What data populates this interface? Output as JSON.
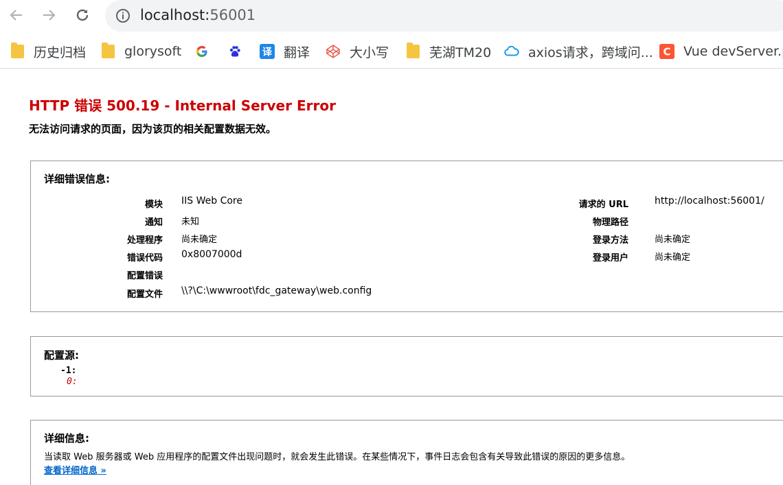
{
  "browser": {
    "url_host": "localhost:",
    "url_port": "56001",
    "bookmarks": [
      {
        "icon": "folder-icon",
        "label": "历史归档"
      },
      {
        "icon": "folder-icon",
        "label": "glorysoft"
      },
      {
        "icon": "google-icon",
        "label": ""
      },
      {
        "icon": "baidu-icon",
        "label": ""
      },
      {
        "icon": "translate-icon",
        "label": "翻译"
      },
      {
        "icon": "codepen-icon",
        "label": "大小写"
      },
      {
        "icon": "folder-icon",
        "label": "芜湖TM20"
      },
      {
        "icon": "cloud-icon",
        "label": "axios请求，跨域问..."
      },
      {
        "icon": "csdn-icon",
        "label": "Vue devServer.pr"
      }
    ]
  },
  "page": {
    "title": "HTTP 错误 500.19 - Internal Server Error",
    "subtitle": "无法访问请求的页面，因为该页的相关配置数据无效。",
    "details": {
      "heading": "详细错误信息:",
      "left": [
        {
          "key": "模块",
          "value": "IIS Web Core"
        },
        {
          "key": "通知",
          "value": "未知"
        },
        {
          "key": "处理程序",
          "value": "尚未确定"
        },
        {
          "key": "错误代码",
          "value": "0x8007000d"
        },
        {
          "key": "配置错误",
          "value": ""
        },
        {
          "key": "配置文件",
          "value": "\\\\?\\C:\\wwwroot\\fdc_gateway\\web.config"
        }
      ],
      "right": [
        {
          "key": "请求的 URL",
          "value": "http://localhost:56001/"
        },
        {
          "key": "物理路径",
          "value": ""
        },
        {
          "key": "登录方法",
          "value": "尚未确定"
        },
        {
          "key": "登录用户",
          "value": "尚未确定"
        }
      ]
    },
    "config_source": {
      "heading": "配置源:",
      "line1": "-1:",
      "line2": "0:"
    },
    "more_info": {
      "heading": "详细信息:",
      "text": "当读取 Web 服务器或 Web 应用程序的配置文件出现问题时，就会发生此错误。在某些情况下，事件日志会包含有关导致此错误的原因的更多信息。",
      "link": "查看详细信息 »"
    }
  },
  "colors": {
    "error_red": "#cc0000",
    "link_blue": "#0066cc"
  }
}
